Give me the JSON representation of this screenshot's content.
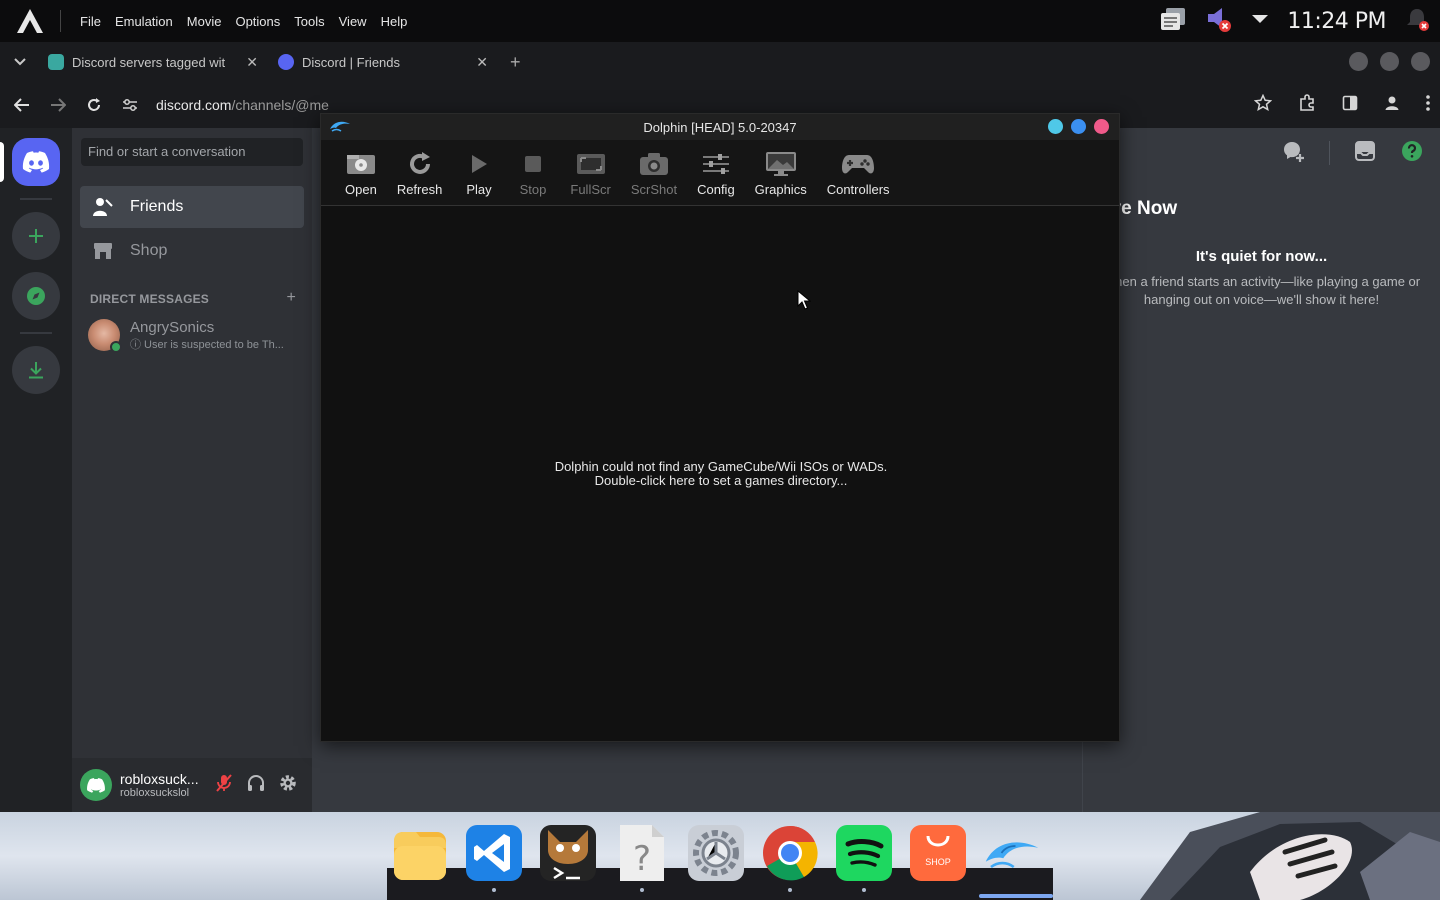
{
  "topbar": {
    "menus": [
      "File",
      "Emulation",
      "Movie",
      "Options",
      "Tools",
      "View",
      "Help"
    ],
    "clock": "11:24 PM",
    "icons": [
      "arch-logo-icon",
      "notes-icon",
      "muted-speaker-icon",
      "dropdown-icon",
      "bell-icon"
    ]
  },
  "browser": {
    "tabs": [
      {
        "title": "Discord servers tagged wit",
        "close": "✕"
      },
      {
        "title": "Discord | Friends",
        "close": "✕"
      }
    ],
    "new_tab": "+",
    "url_host": "discord.com",
    "url_path": "/channels/@me"
  },
  "discord": {
    "search_placeholder": "Find or start a conversation",
    "nav": {
      "friends": "Friends",
      "shop": "Shop"
    },
    "dm_header": "DIRECT MESSAGES",
    "dm_add": "+",
    "dm": {
      "name": "AngrySonics",
      "sub": "ⓘ User is suspected to be Th..."
    },
    "user": {
      "name": "robloxsuck...",
      "tag": "robloxsuckslol"
    },
    "active_now_title": "tive Now",
    "quiet_title": "It's quiet for now...",
    "quiet_text": "When a friend starts an activity—like playing a game or hanging out on voice—we'll show it here!"
  },
  "dolphin": {
    "title": "Dolphin [HEAD] 5.0-20347",
    "toolbar": {
      "open": "Open",
      "refresh": "Refresh",
      "play": "Play",
      "stop": "Stop",
      "fullscr": "FullScr",
      "scrshot": "ScrShot",
      "config": "Config",
      "graphics": "Graphics",
      "controllers": "Controllers"
    },
    "empty_line1": "Dolphin could not find any GameCube/Wii ISOs or WADs.",
    "empty_line2": "Double-click here to set a games directory..."
  },
  "dock": {
    "shop_label": "SHOP",
    "apps": [
      "files",
      "vscode",
      "terminal",
      "unknown-file",
      "settings",
      "chrome",
      "spotify",
      "shop",
      "dolphin"
    ]
  },
  "colors": {
    "discord_blurple": "#5865f2",
    "discord_green": "#3ba55d",
    "dolphin_bg": "#111111"
  }
}
